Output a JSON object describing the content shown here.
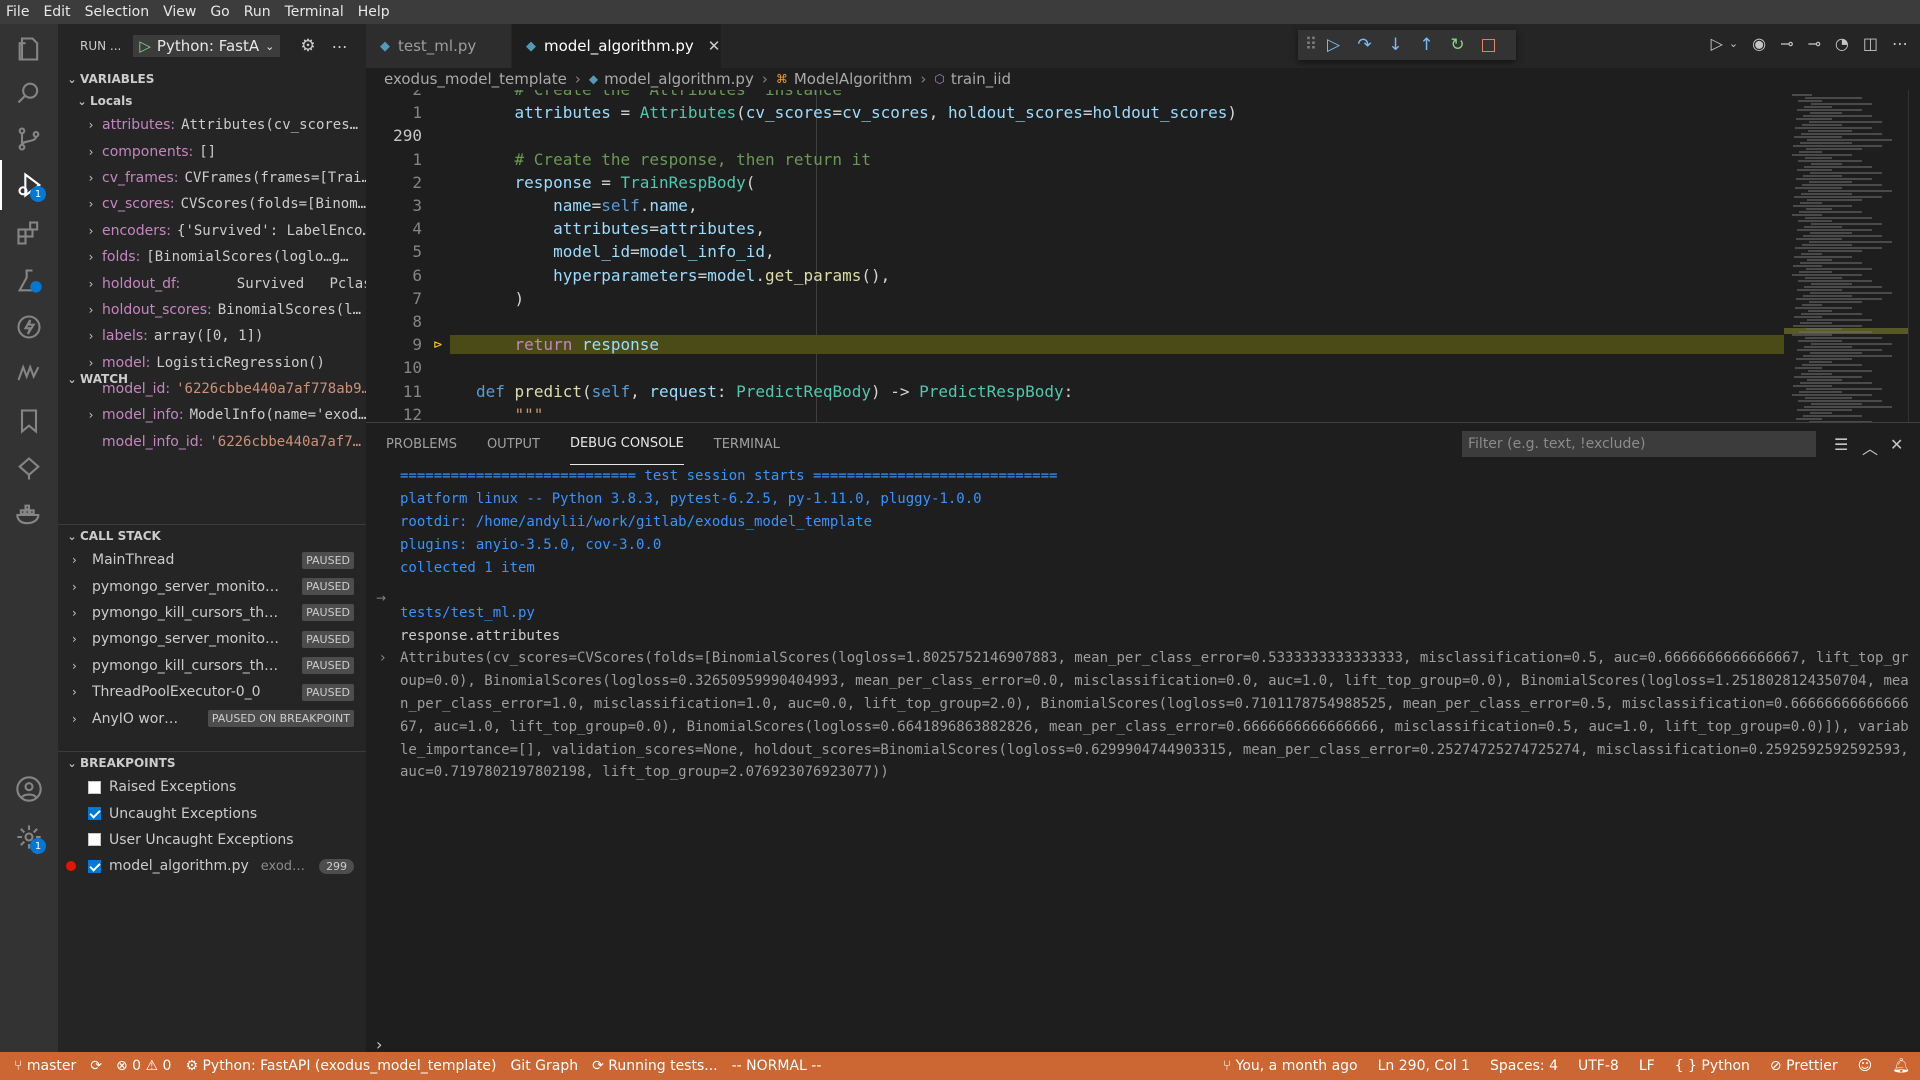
{
  "menu": [
    "File",
    "Edit",
    "Selection",
    "View",
    "Go",
    "Run",
    "Terminal",
    "Help"
  ],
  "activity": {
    "debug_badge": "1",
    "settings_badge": "1"
  },
  "sidebar": {
    "run_label": "RUN ...",
    "config": "Python: FastA",
    "variables_title": "VARIABLES",
    "locals_title": "Locals",
    "locals": [
      {
        "name": "attributes:",
        "value": "Attributes(cv_scores…",
        "type": "plain",
        "expandable": true
      },
      {
        "name": "components:",
        "value": "[]",
        "type": "plain",
        "expandable": true
      },
      {
        "name": "cv_frames:",
        "value": "CVFrames(frames=[Trai…",
        "type": "plain",
        "expandable": true
      },
      {
        "name": "cv_scores:",
        "value": "CVScores(folds=[Binom…",
        "type": "plain",
        "expandable": true
      },
      {
        "name": "encoders:",
        "value": "{'Survived': LabelEnco…",
        "type": "plain",
        "expandable": true
      },
      {
        "name": "folds:",
        "value": "[BinomialScores(loglo…g…",
        "type": "plain",
        "expandable": true
      },
      {
        "name": "holdout_df:",
        "value": "      Survived   Pclass…",
        "type": "plain",
        "expandable": true
      },
      {
        "name": "holdout_scores:",
        "value": "BinomialScores(l…",
        "type": "plain",
        "expandable": true
      },
      {
        "name": "labels:",
        "value": "array([0, 1])",
        "type": "plain",
        "expandable": true
      },
      {
        "name": "model:",
        "value": "LogisticRegression()",
        "type": "plain",
        "expandable": true
      },
      {
        "name": "model_id:",
        "value": "'6226cbbe440a7af778ab9…",
        "type": "str",
        "expandable": false
      },
      {
        "name": "model_info:",
        "value": "ModelInfo(name='exod…",
        "type": "plain",
        "expandable": true
      },
      {
        "name": "model_info_id:",
        "value": "'6226cbbe440a7af7…",
        "type": "str",
        "expandable": false
      }
    ],
    "watch_title": "WATCH",
    "callstack_title": "CALL STACK",
    "callstack": [
      {
        "name": "MainThread",
        "state": "PAUSED"
      },
      {
        "name": "pymongo_server_monito…",
        "state": "PAUSED"
      },
      {
        "name": "pymongo_kill_cursors_th…",
        "state": "PAUSED"
      },
      {
        "name": "pymongo_server_monito…",
        "state": "PAUSED"
      },
      {
        "name": "pymongo_kill_cursors_th…",
        "state": "PAUSED"
      },
      {
        "name": "ThreadPoolExecutor-0_0",
        "state": "PAUSED"
      },
      {
        "name": "AnyIO wor…",
        "state": "PAUSED ON BREAKPOINT"
      }
    ],
    "breakpoints_title": "BREAKPOINTS",
    "breakpoints": [
      {
        "label": "Raised Exceptions",
        "checked": false
      },
      {
        "label": "Uncaught Exceptions",
        "checked": true
      },
      {
        "label": "User Uncaught Exceptions",
        "checked": false
      }
    ],
    "bp_file": {
      "label": "model_algorithm.py",
      "path": "exod…",
      "line": "299"
    }
  },
  "tabs": [
    {
      "label": "test_ml.py",
      "active": false
    },
    {
      "label": "model_algorithm.py",
      "active": true
    }
  ],
  "breadcrumb": [
    "exodus_model_template",
    "model_algorithm.py",
    "ModelAlgorithm",
    "train_iid"
  ],
  "code_lines": [
    {
      "ln": "2",
      "text": "    # Create the  Attributes  instance"
    },
    {
      "ln": "1",
      "text": "    attributes = Attributes(cv_scores=cv_scores, holdout_scores=holdout_scores)"
    },
    {
      "ln": "290",
      "text": ""
    },
    {
      "ln": "1",
      "text": "    # Create the response, then return it"
    },
    {
      "ln": "2",
      "text": "    response = TrainRespBody("
    },
    {
      "ln": "3",
      "text": "        name=self.name,"
    },
    {
      "ln": "4",
      "text": "        attributes=attributes,"
    },
    {
      "ln": "5",
      "text": "        model_id=model_info_id,"
    },
    {
      "ln": "6",
      "text": "        hyperparameters=model.get_params(),"
    },
    {
      "ln": "7",
      "text": "    )"
    },
    {
      "ln": "8",
      "text": ""
    },
    {
      "ln": "9",
      "text": "    return response"
    },
    {
      "ln": "10",
      "text": ""
    },
    {
      "ln": "11",
      "text": "def predict(self, request: PredictReqBody) -> PredictRespBody:"
    },
    {
      "ln": "12",
      "text": "    \"\"\""
    }
  ],
  "panel": {
    "tabs": [
      "PROBLEMS",
      "OUTPUT",
      "DEBUG CONSOLE",
      "TERMINAL"
    ],
    "active_tab": "DEBUG CONSOLE",
    "filter_placeholder": "Filter (e.g. text, !exclude)",
    "console": [
      {
        "text": "============================ test session starts =============================",
        "style": "blue"
      },
      {
        "text": "platform linux -- Python 3.8.3, pytest-6.2.5, py-1.11.0, pluggy-1.0.0",
        "style": "blue"
      },
      {
        "text": "rootdir: /home/andylii/work/gitlab/exodus_model_template",
        "style": "blue"
      },
      {
        "text": "plugins: anyio-3.5.0, cov-3.0.0",
        "style": "blue"
      },
      {
        "text": "collected 1 item",
        "style": "blue"
      },
      {
        "text": "",
        "style": "blue"
      },
      {
        "text": "tests/test_ml.py",
        "style": "blue"
      },
      {
        "text": "response.attributes",
        "style": "plain"
      }
    ],
    "result": "Attributes(cv_scores=CVScores(folds=[BinomialScores(logloss=1.8025752146907883, mean_per_class_error=0.5333333333333333, misclassification=0.5, auc=0.6666666666666667, lift_top_group=0.0), BinomialScores(logloss=0.32650959990404993, mean_per_class_error=0.0, misclassification=0.0, auc=1.0, lift_top_group=0.0), BinomialScores(logloss=1.2518028124350704, mean_per_class_error=1.0, misclassification=1.0, auc=0.0, lift_top_group=2.0), BinomialScores(logloss=0.7101178754988525, mean_per_class_error=0.5, misclassification=0.6666666666666667, auc=1.0, lift_top_group=0.0), BinomialScores(logloss=0.6641896863882826, mean_per_class_error=0.6666666666666666, misclassification=0.5, auc=1.0, lift_top_group=0.0)]), variable_importance=[], validation_scores=None, holdout_scores=BinomialScores(logloss=0.6299904744903315, mean_per_class_error=0.25274725274725274, misclassification=0.2592592592592593, auc=0.7197802197802198, lift_top_group=2.076923076923077))"
  },
  "status": {
    "branch": "master",
    "errors": "0",
    "warnings": "0",
    "debug_config": "Python: FastAPI (exodus_model_template)",
    "git_graph": "Git Graph",
    "running": "Running tests...",
    "mode": "-- NORMAL --",
    "blame": "You, a month ago",
    "position": "Ln 290, Col 1",
    "spaces": "Spaces: 4",
    "encoding": "UTF-8",
    "eol": "LF",
    "language": "Python",
    "formatter": "Prettier"
  },
  "colors": {
    "statusbar": "#cc6633",
    "accent": "#0078d4",
    "highlight_line": "#4b4b18"
  }
}
